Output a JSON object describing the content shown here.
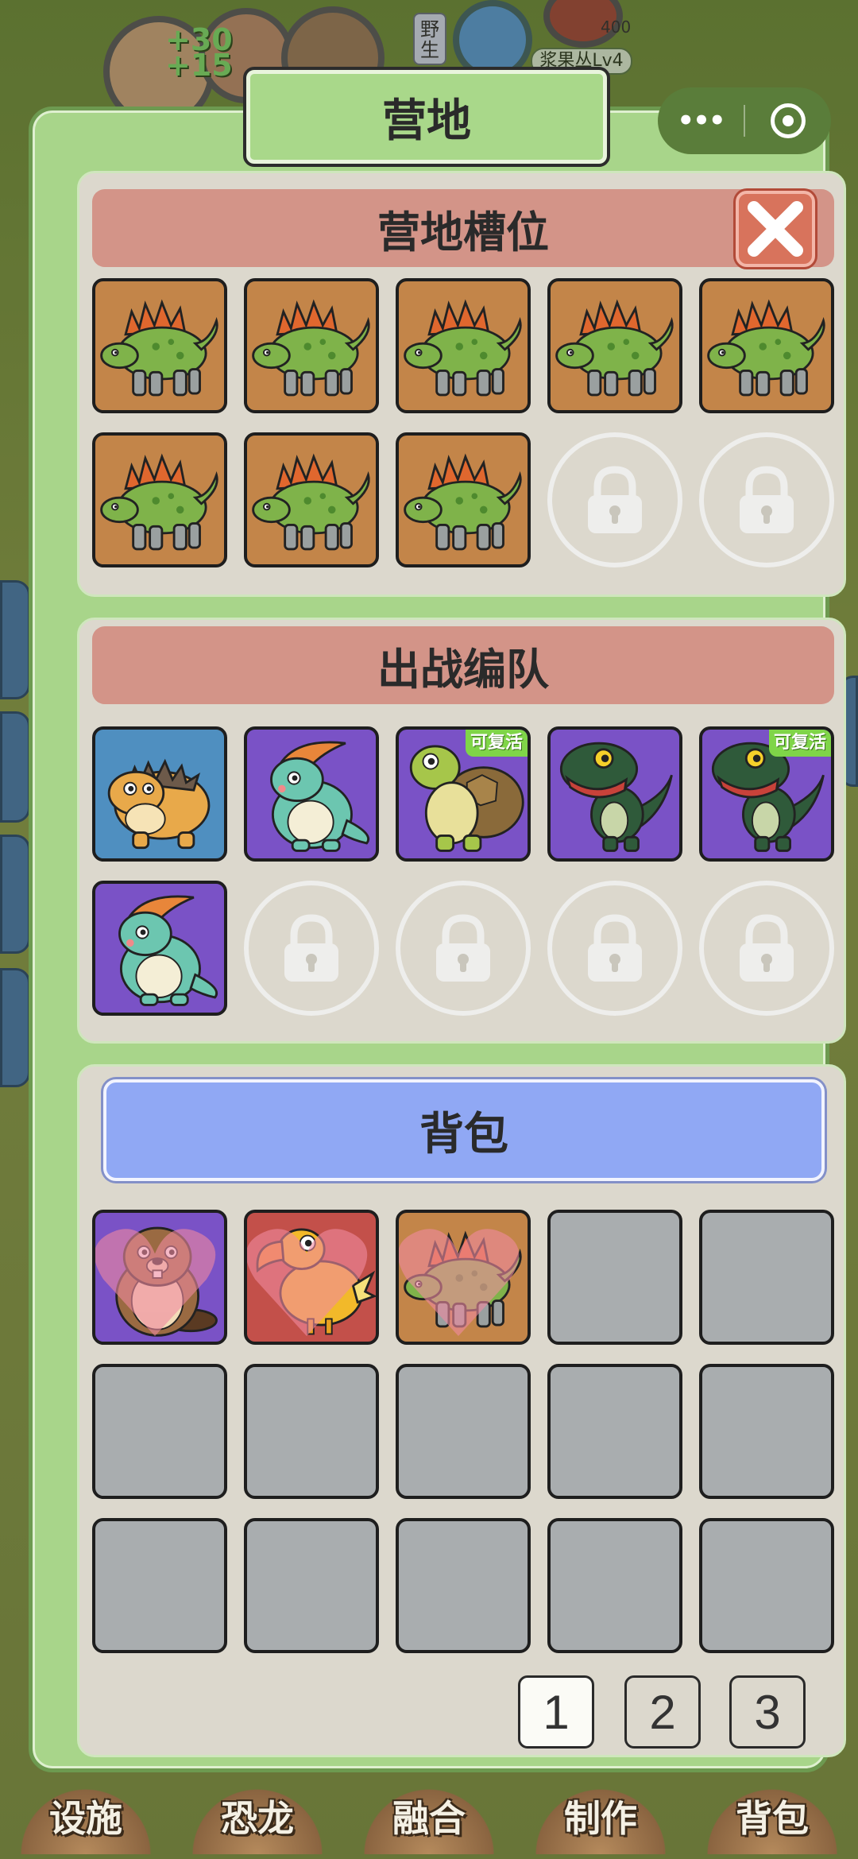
{
  "background": {
    "stat_text": "+30\n+15",
    "wild_badge": "野\n生",
    "level_label": "浆果丛Lv4",
    "count_label": "400"
  },
  "bottom_nav": [
    "设施",
    "恐龙",
    "融合",
    "制作",
    "背包"
  ],
  "capsule": {
    "more_icon": "more-dots-icon",
    "close_icon": "target-circle-icon"
  },
  "modal": {
    "title": "营地",
    "close_icon": "close-x-icon",
    "camp_slots": {
      "header": "营地槽位",
      "slots": [
        {
          "creature": "stegosaurus",
          "bg": "orange"
        },
        {
          "creature": "stegosaurus",
          "bg": "orange"
        },
        {
          "creature": "stegosaurus",
          "bg": "orange"
        },
        {
          "creature": "stegosaurus",
          "bg": "orange"
        },
        {
          "creature": "stegosaurus",
          "bg": "orange"
        },
        {
          "creature": "stegosaurus",
          "bg": "orange"
        },
        {
          "creature": "stegosaurus",
          "bg": "orange"
        },
        {
          "creature": "stegosaurus",
          "bg": "orange"
        },
        {
          "locked": true
        },
        {
          "locked": true
        }
      ]
    },
    "battle_team": {
      "header": "出战编队",
      "revive_label": "可复活",
      "slots": [
        {
          "creature": "ankylosaurus",
          "bg": "blue"
        },
        {
          "creature": "parasaurolophus",
          "bg": "purple"
        },
        {
          "creature": "turtle",
          "bg": "purple",
          "revive": true
        },
        {
          "creature": "t-rex",
          "bg": "purple"
        },
        {
          "creature": "t-rex",
          "bg": "purple",
          "revive": true
        },
        {
          "creature": "parasaurolophus",
          "bg": "purple"
        },
        {
          "locked": true
        },
        {
          "locked": true
        },
        {
          "locked": true
        },
        {
          "locked": true
        }
      ]
    },
    "backpack": {
      "header": "背包",
      "slots": [
        {
          "creature": "beaver",
          "bg": "purple",
          "favorite": true
        },
        {
          "creature": "dodo",
          "bg": "red",
          "favorite": true
        },
        {
          "creature": "stegosaurus",
          "bg": "orange",
          "favorite": true
        },
        {},
        {},
        {},
        {},
        {},
        {},
        {},
        {},
        {},
        {},
        {},
        {}
      ],
      "pages": [
        "1",
        "2",
        "3"
      ],
      "active_page": "1"
    }
  },
  "colors": {
    "modal_green": "#a8d58a",
    "header_red": "#d39488",
    "backpack_blue": "#90a8f4",
    "slot_orange": "#c38549",
    "slot_purple": "#7a52c6",
    "slot_blue": "#4f8fc0",
    "slot_red": "#c3504a",
    "slot_empty": "#a9adaf"
  }
}
